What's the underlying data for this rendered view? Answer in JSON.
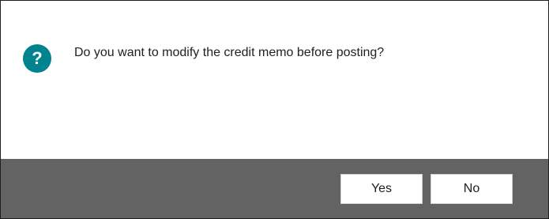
{
  "dialog": {
    "icon": "question-icon",
    "icon_glyph": "?",
    "icon_color": "#00838f",
    "message": "Do you want to modify the credit memo before posting?",
    "footer_color": "#636363",
    "buttons": {
      "yes_label": "Yes",
      "no_label": "No"
    }
  }
}
